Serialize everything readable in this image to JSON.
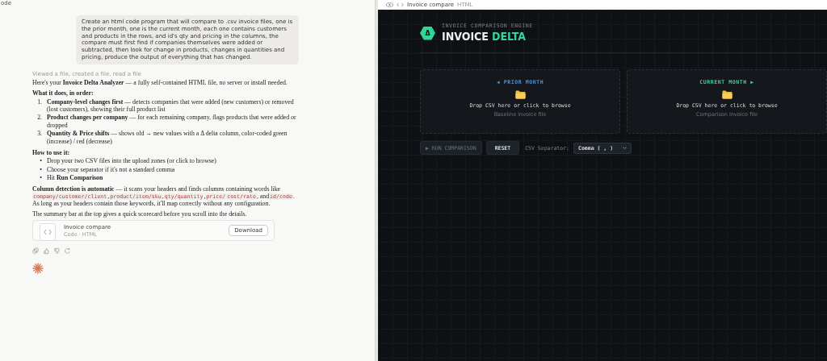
{
  "top_bar": {
    "label": "ode"
  },
  "chat": {
    "user_message": "Create an html code program that will compare to .csv invoice files, one is the prior month, one is the current month, each one contains customers and products in the rows, and id's qty and pricing in the columns, the compare must first find if companies themselves were added or subtracted, then look for change in products, changes in quantities and pricing, produce the output of everything that has changed.",
    "tool_summary": "Viewed a file, created a file, read a file",
    "blocks": [
      {
        "kind": "paragraph",
        "text": "Here's your **Invoice Delta Analyzer** — a fully self-contained HTML file, no server or install needed."
      },
      {
        "kind": "heading",
        "text": "What it does, in order:"
      },
      {
        "kind": "ordered_list",
        "items": [
          {
            "marker": "1.",
            "text": "**Company-level changes first** — detects companies that were added (new customers) or removed (lost customers), showing their full product list"
          },
          {
            "marker": "2.",
            "text": "**Product changes per company** — for each remaining company, flags products that were added or dropped"
          },
          {
            "marker": "3.",
            "text": "**Quantity & Price shifts** — shows old → new values with a Δ delta column, color-coded green (increase) / red (decrease)"
          }
        ]
      },
      {
        "kind": "heading",
        "text": "How to use it:"
      },
      {
        "kind": "bullet_list",
        "items": [
          {
            "marker": "•",
            "text": "Drop your two CSV files into the upload zones (or click to browse)"
          },
          {
            "marker": "•",
            "text": "Choose your separator if it's not a standard comma"
          },
          {
            "marker": "•",
            "text": "Hit **Run Comparison**"
          }
        ]
      },
      {
        "kind": "segments",
        "parts": [
          {
            "kind": "text",
            "text": "**Column detection is automatic** — it scans your headers and finds columns containing words like "
          },
          {
            "kind": "code",
            "text": "company/customer/client"
          },
          {
            "kind": "text",
            "text": ","
          },
          {
            "kind": "code",
            "text": "product/item/sku"
          },
          {
            "kind": "text",
            "text": ","
          },
          {
            "kind": "code",
            "text": "qty/quantity"
          },
          {
            "kind": "text",
            "text": ","
          },
          {
            "kind": "code",
            "text": "price/"
          },
          {
            "kind": "code",
            "text": "cost/rate"
          },
          {
            "kind": "text",
            "text": ", and"
          },
          {
            "kind": "code",
            "text": "id/code"
          },
          {
            "kind": "text",
            "text": ". As long as your headers contain those keywords, it'll map correctly without any configuration."
          }
        ]
      },
      {
        "kind": "paragraph",
        "text": "The summary bar at the top gives a quick scorecard before you scroll into the details."
      }
    ],
    "artifact": {
      "title": "Invoice compare",
      "subtitle": "Code · HTML",
      "button": "Download"
    }
  },
  "preview": {
    "tab_title": "Invoice compare",
    "tab_type": "HTML",
    "app": {
      "eyebrow": "INVOICE COMPARISON ENGINE",
      "logo_glyph": "Δ",
      "title_main": "INVOICE",
      "title_accent": "DELTA",
      "drop_zones": [
        {
          "label": "◀ PRIOR MONTH",
          "color": "#4a8fd8",
          "prompt": "Drop CSV here or click to browse",
          "hint": "Baseline invoice file"
        },
        {
          "label": "CURRENT MONTH ▶",
          "color": "#2ed69a",
          "prompt": "Drop CSV here or click to browse",
          "hint": "Comparison invoice file"
        }
      ],
      "run_button": {
        "label": "▶ RUN COMPARISON",
        "disabled": true
      },
      "reset_button": "RESET",
      "separator_label": "CSV Separator:",
      "separator_value": "Comma ( , )"
    }
  }
}
